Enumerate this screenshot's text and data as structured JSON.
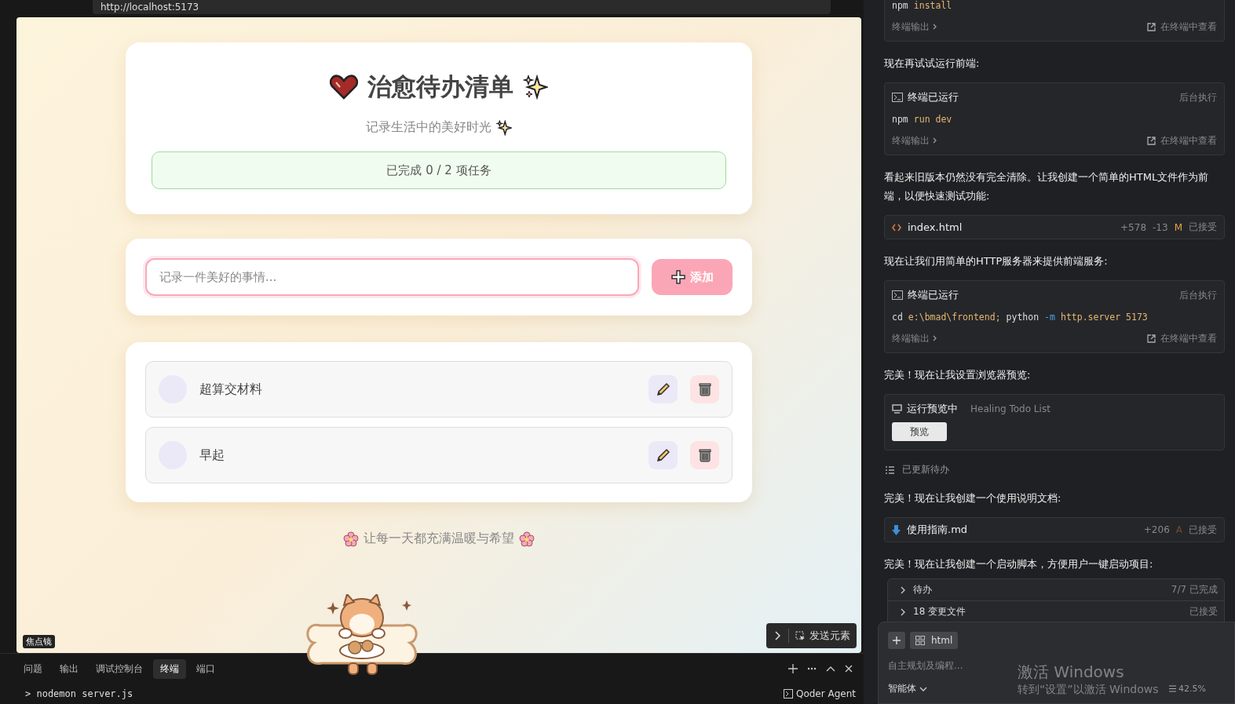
{
  "browser": {
    "url": "http://localhost:5173"
  },
  "app": {
    "title": "治愈待办清单",
    "subtitle": "记录生活中的美好时光",
    "progress": "已完成 0 / 2 项任务",
    "input": {
      "placeholder": "记录一件美好的事情..."
    },
    "add_button": "添加",
    "todos": [
      {
        "text": "超算交材料",
        "done": false
      },
      {
        "text": "早起",
        "done": false
      }
    ],
    "footer": "让每一天都充满温暖与希望"
  },
  "preview_badge": "焦点镜",
  "send_button": "发送元素",
  "panel": {
    "tabs": [
      {
        "label": "问题",
        "selected": false
      },
      {
        "label": "输出",
        "selected": false
      },
      {
        "label": "调试控制台",
        "selected": false
      },
      {
        "label": "终端",
        "selected": true
      },
      {
        "label": "端口",
        "selected": false
      }
    ],
    "terminal_line": "> nodemon server.js",
    "agent_label": "Qoder Agent"
  },
  "chat": {
    "blocks": [
      {
        "kind": "terminal",
        "command": [
          {
            "text": "npm",
            "kind": "cmd"
          },
          {
            "text": "install",
            "kind": "arg"
          }
        ],
        "output": "终端输出",
        "open": "在终端中查看"
      },
      {
        "kind": "text",
        "text": "现在再试试运行前端:"
      },
      {
        "kind": "terminal",
        "title": "终端已运行",
        "status": "后台执行",
        "command": [
          {
            "text": "npm",
            "kind": "cmd"
          },
          {
            "text": "run dev",
            "kind": "arg"
          }
        ],
        "output": "终端输出",
        "open": "在终端中查看"
      },
      {
        "kind": "text",
        "text": "看起来旧版本仍然没有完全清除。让我创建一个简单的HTML文件作为前端，以便快速测试功能:"
      },
      {
        "kind": "code_file",
        "name": "index.html",
        "added": "+578",
        "removed": "-13",
        "badge": "M",
        "status": "已接受"
      },
      {
        "kind": "text",
        "text": "现在让我们用简单的HTTP服务器来提供前端服务:"
      },
      {
        "kind": "terminal",
        "title": "终端已运行",
        "status": "后台执行",
        "command": [
          {
            "text": "cd",
            "kind": "cmd"
          },
          {
            "text": "e:\\bmad\\frontend;",
            "kind": "arg"
          },
          {
            "text": "python",
            "kind": "cmd"
          },
          {
            "text": "-m",
            "kind": "flag"
          },
          {
            "text": "http.server 5173",
            "kind": "arg"
          }
        ],
        "output": "终端输出",
        "open": "在终端中查看"
      },
      {
        "kind": "text",
        "text": "完美！现在让我设置浏览器预览:"
      },
      {
        "kind": "preview",
        "title": "运行预览中",
        "subtitle": "Healing Todo List",
        "button": "预览"
      },
      {
        "kind": "status",
        "text": "已更新待办"
      },
      {
        "kind": "text",
        "text": "完美！现在让我创建一个使用说明文档:"
      },
      {
        "kind": "doc_file",
        "name": "使用指南.md",
        "added": "+206",
        "badge": "A",
        "status": "已接受"
      },
      {
        "kind": "text",
        "text": "完美！现在让我创建一个启动脚本，方便用户一键启动项目:"
      }
    ],
    "summary": [
      {
        "label": "待办",
        "status": "7/7 已完成"
      },
      {
        "label": "18 变更文件",
        "status": "已接受"
      }
    ],
    "composer": {
      "chip": "html",
      "placeholder": "自主规划及编程...",
      "mode": "智能体",
      "zoom": "42.5%"
    }
  },
  "os_overlay": {
    "title": "激活 Windows",
    "hint": "转到“设置”以激活 Windows"
  }
}
